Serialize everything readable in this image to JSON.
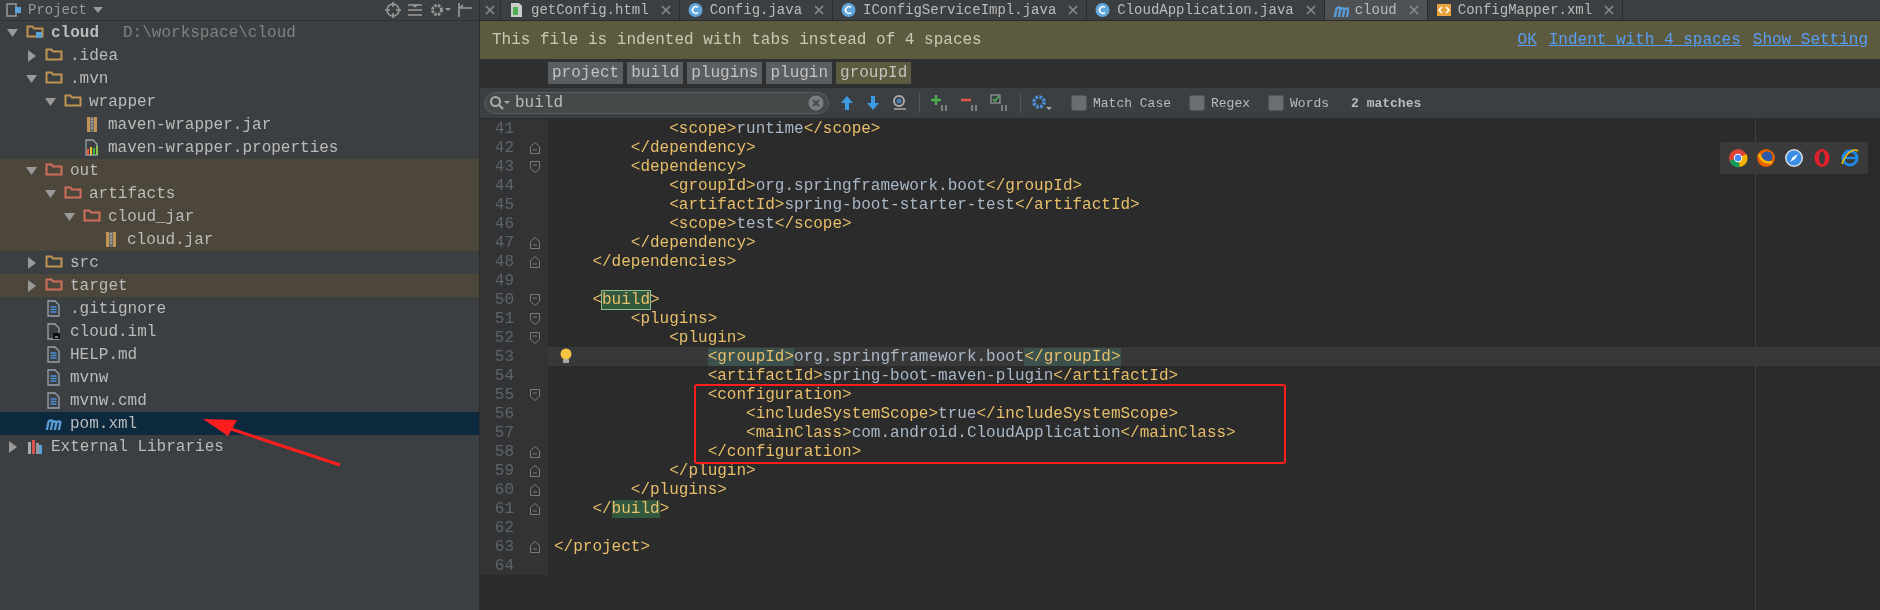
{
  "project_panel": {
    "title": "Project",
    "tree": [
      {
        "name": "cloud",
        "path": "D:\\workspace\\cloud",
        "kind": "module",
        "expanded": true,
        "excluded": false,
        "selected": false,
        "children": [
          {
            "name": ".idea",
            "kind": "folder",
            "expanded": false,
            "excluded": false,
            "selected": false
          },
          {
            "name": ".mvn",
            "kind": "folder",
            "expanded": true,
            "excluded": false,
            "selected": false,
            "children": [
              {
                "name": "wrapper",
                "kind": "folder",
                "expanded": true,
                "excluded": false,
                "selected": false,
                "children": [
                  {
                    "name": "maven-wrapper.jar",
                    "kind": "jar",
                    "excluded": false,
                    "selected": false
                  },
                  {
                    "name": "maven-wrapper.properties",
                    "kind": "properties",
                    "excluded": false,
                    "selected": false
                  }
                ]
              }
            ]
          },
          {
            "name": "out",
            "kind": "folder",
            "expanded": true,
            "excluded": true,
            "selected": false,
            "children": [
              {
                "name": "artifacts",
                "kind": "folder",
                "expanded": true,
                "excluded": true,
                "selected": false,
                "children": [
                  {
                    "name": "cloud_jar",
                    "kind": "folder",
                    "expanded": true,
                    "excluded": true,
                    "selected": false,
                    "children": [
                      {
                        "name": "cloud.jar",
                        "kind": "jar",
                        "excluded": true,
                        "selected": false
                      }
                    ]
                  }
                ]
              }
            ]
          },
          {
            "name": "src",
            "kind": "folder",
            "expanded": false,
            "excluded": false,
            "selected": false
          },
          {
            "name": "target",
            "kind": "folder",
            "expanded": false,
            "excluded": true,
            "selected": false
          },
          {
            "name": ".gitignore",
            "kind": "text",
            "excluded": false,
            "selected": false
          },
          {
            "name": "cloud.iml",
            "kind": "iml",
            "excluded": false,
            "selected": false
          },
          {
            "name": "HELP.md",
            "kind": "text",
            "excluded": false,
            "selected": false
          },
          {
            "name": "mvnw",
            "kind": "text",
            "excluded": false,
            "selected": false
          },
          {
            "name": "mvnw.cmd",
            "kind": "text",
            "excluded": false,
            "selected": false
          },
          {
            "name": "pom.xml",
            "kind": "maven",
            "excluded": false,
            "selected": true
          }
        ]
      },
      {
        "name": "External Libraries",
        "kind": "libraries",
        "expanded": false,
        "excluded": false,
        "selected": false
      }
    ]
  },
  "tabs": [
    {
      "label": "getConfig.html",
      "kind": "html",
      "selected": false
    },
    {
      "label": "Config.java",
      "kind": "java",
      "selected": false
    },
    {
      "label": "IConfigServiceImpl.java",
      "kind": "java",
      "selected": false
    },
    {
      "label": "CloudApplication.java",
      "kind": "java",
      "selected": false
    },
    {
      "label": "cloud",
      "kind": "maven",
      "selected": true
    },
    {
      "label": "ConfigMapper.xml",
      "kind": "xml",
      "selected": false
    }
  ],
  "notification": {
    "message": "This file is indented with tabs instead of 4 spaces",
    "actions": [
      "OK",
      "Indent with 4 spaces",
      "Show Setting"
    ]
  },
  "breadcrumbs": [
    {
      "label": "project",
      "selected": false
    },
    {
      "label": "build",
      "selected": false
    },
    {
      "label": "plugins",
      "selected": false
    },
    {
      "label": "plugin",
      "selected": false
    },
    {
      "label": "groupId",
      "selected": true
    }
  ],
  "search": {
    "value": "build",
    "options": [
      {
        "label": "Match Case",
        "checked": false
      },
      {
        "label": "Regex",
        "checked": false
      },
      {
        "label": "Words",
        "checked": false
      }
    ],
    "matches": "2 matches"
  },
  "editor": {
    "lines": [
      {
        "number": "41",
        "current": false,
        "fold_start": false,
        "fold_end": false,
        "segments": [
          {
            "kind": "tag",
            "text": "            <scope>"
          },
          {
            "kind": "text",
            "text": "runtime"
          },
          {
            "kind": "tag",
            "text": "</scope>"
          }
        ]
      },
      {
        "number": "42",
        "current": false,
        "fold_start": false,
        "fold_end": true,
        "segments": [
          {
            "kind": "tag",
            "text": "        </dependency>"
          }
        ]
      },
      {
        "number": "43",
        "current": false,
        "fold_start": true,
        "fold_end": false,
        "segments": [
          {
            "kind": "tag",
            "text": "        <dependency>"
          }
        ]
      },
      {
        "number": "44",
        "current": false,
        "fold_start": false,
        "fold_end": false,
        "segments": [
          {
            "kind": "tag",
            "text": "            <groupId>"
          },
          {
            "kind": "text",
            "text": "org.springframework.boot"
          },
          {
            "kind": "tag",
            "text": "</groupId>"
          }
        ]
      },
      {
        "number": "45",
        "current": false,
        "fold_start": false,
        "fold_end": false,
        "segments": [
          {
            "kind": "tag",
            "text": "            <artifactId>"
          },
          {
            "kind": "text",
            "text": "spring-boot-starter-test"
          },
          {
            "kind": "tag",
            "text": "</artifactId>"
          }
        ]
      },
      {
        "number": "46",
        "current": false,
        "fold_start": false,
        "fold_end": false,
        "segments": [
          {
            "kind": "tag",
            "text": "            <scope>"
          },
          {
            "kind": "text",
            "text": "test"
          },
          {
            "kind": "tag",
            "text": "</scope>"
          }
        ]
      },
      {
        "number": "47",
        "current": false,
        "fold_start": false,
        "fold_end": true,
        "segments": [
          {
            "kind": "tag",
            "text": "        </dependency>"
          }
        ]
      },
      {
        "number": "48",
        "current": false,
        "fold_start": false,
        "fold_end": true,
        "segments": [
          {
            "kind": "tag",
            "text": "    </dependencies>"
          }
        ]
      },
      {
        "number": "49",
        "current": false,
        "fold_start": false,
        "fold_end": false
      },
      {
        "number": "50",
        "current": false,
        "fold_start": true,
        "fold_end": false,
        "segments": [
          {
            "kind": "tag",
            "text": "    <"
          },
          {
            "kind": "current-match",
            "text": "build"
          },
          {
            "kind": "tag",
            "text": ">"
          }
        ]
      },
      {
        "number": "51",
        "current": false,
        "fold_start": true,
        "fold_end": false,
        "segments": [
          {
            "kind": "tag",
            "text": "        <plugins>"
          }
        ]
      },
      {
        "number": "52",
        "current": false,
        "fold_start": true,
        "fold_end": false,
        "segments": [
          {
            "kind": "tag",
            "text": "            <plugin>"
          }
        ]
      },
      {
        "number": "53",
        "current": true,
        "fold_start": false,
        "fold_end": false,
        "segments": [
          {
            "kind": "brace",
            "text": "                <groupId>"
          },
          {
            "kind": "text",
            "text": "org.springframework.boot"
          },
          {
            "kind": "brace",
            "text": "</groupId>"
          }
        ]
      },
      {
        "number": "54",
        "current": false,
        "fold_start": false,
        "fold_end": false,
        "segments": [
          {
            "kind": "tag",
            "text": "                <artifactId>"
          },
          {
            "kind": "text",
            "text": "spring-boot-maven-plugin"
          },
          {
            "kind": "tag",
            "text": "</artifactId>"
          }
        ]
      },
      {
        "number": "55",
        "current": false,
        "fold_start": true,
        "fold_end": false,
        "segments": [
          {
            "kind": "tag",
            "text": "                <configuration>"
          }
        ]
      },
      {
        "number": "56",
        "current": false,
        "fold_start": false,
        "fold_end": false,
        "segments": [
          {
            "kind": "tag",
            "text": "                    <includeSystemScope>"
          },
          {
            "kind": "text",
            "text": "true"
          },
          {
            "kind": "tag",
            "text": "</includeSystemScope>"
          }
        ]
      },
      {
        "number": "57",
        "current": false,
        "fold_start": false,
        "fold_end": false,
        "segments": [
          {
            "kind": "tag",
            "text": "                    <mainClass>"
          },
          {
            "kind": "text",
            "text": "com.android.CloudApplication"
          },
          {
            "kind": "tag",
            "text": "</mainClass>"
          }
        ]
      },
      {
        "number": "58",
        "current": false,
        "fold_start": false,
        "fold_end": true,
        "segments": [
          {
            "kind": "tag",
            "text": "                </configuration>"
          }
        ]
      },
      {
        "number": "59",
        "current": false,
        "fold_start": false,
        "fold_end": true,
        "segments": [
          {
            "kind": "tag",
            "text": "            </plugin>"
          }
        ]
      },
      {
        "number": "60",
        "current": false,
        "fold_start": false,
        "fold_end": true,
        "segments": [
          {
            "kind": "tag",
            "text": "        </plugins>"
          }
        ]
      },
      {
        "number": "61",
        "current": false,
        "fold_start": false,
        "fold_end": true,
        "segments": [
          {
            "kind": "tag",
            "text": "    </"
          },
          {
            "kind": "match",
            "text": "build"
          },
          {
            "kind": "tag",
            "text": ">"
          }
        ]
      },
      {
        "number": "62",
        "current": false,
        "fold_start": false,
        "fold_end": false
      },
      {
        "number": "63",
        "current": false,
        "fold_start": false,
        "fold_end": true,
        "segments": [
          {
            "kind": "tag",
            "text": "</project>"
          }
        ]
      },
      {
        "number": "64",
        "current": false,
        "fold_start": false,
        "fold_end": false
      }
    ]
  }
}
